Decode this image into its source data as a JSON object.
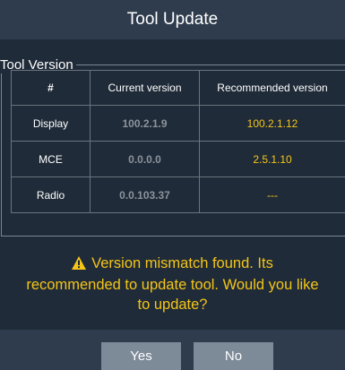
{
  "dialog": {
    "title": "Tool Update",
    "section_label": "Tool Version"
  },
  "table": {
    "columns": [
      "#",
      "Current version",
      "Recommended version"
    ],
    "rows": [
      {
        "name": "Display",
        "current": "100.2.1.9",
        "recommended": "100.2.1.12"
      },
      {
        "name": "MCE",
        "current": "0.0.0.0",
        "recommended": "2.5.1.10"
      },
      {
        "name": "Radio",
        "current": "0.0.103.37",
        "recommended": "---"
      }
    ]
  },
  "message": {
    "icon": "warning-triangle-icon",
    "line1": "Version mismatch found. Its",
    "line2": "recommended to update tool. Would you like",
    "line3": "to update?"
  },
  "buttons": {
    "yes_label": "Yes",
    "no_label": "No"
  },
  "colors": {
    "background": "#1f2b38",
    "header": "#2f3c4d",
    "accent": "#f5c518",
    "button": "#7d8a98",
    "muted_text": "#8b939d"
  }
}
